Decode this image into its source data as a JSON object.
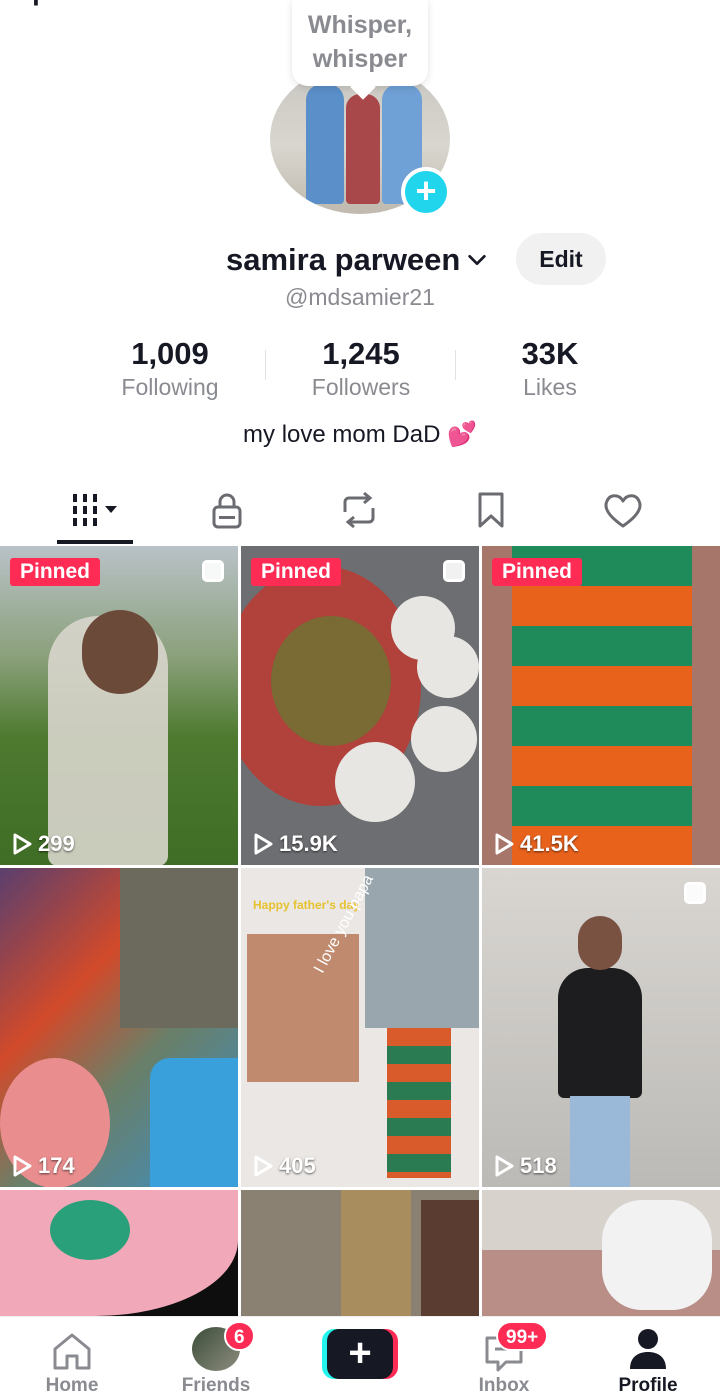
{
  "status": {
    "tooltip": "Whisper, whisper"
  },
  "profile": {
    "display_name": "samira parween",
    "handle": "@mdsamier21",
    "edit_label": "Edit",
    "bio": "my love mom DaD",
    "bio_emoji": "💕"
  },
  "stats": [
    {
      "value": "1,009",
      "label": "Following"
    },
    {
      "value": "1,245",
      "label": "Followers"
    },
    {
      "value": "33K",
      "label": "Likes"
    }
  ],
  "tabs": [
    {
      "icon": "grid-icon",
      "active": true
    },
    {
      "icon": "lock-icon"
    },
    {
      "icon": "repost-icon"
    },
    {
      "icon": "bookmark-icon"
    },
    {
      "icon": "heart-icon"
    }
  ],
  "videos": [
    {
      "pinned_label": "Pinned",
      "views": "299",
      "multi": true
    },
    {
      "pinned_label": "Pinned",
      "views": "15.9K",
      "multi": true
    },
    {
      "pinned_label": "Pinned",
      "views": "41.5K",
      "multi": false
    },
    {
      "views": "174",
      "multi": false
    },
    {
      "views": "405",
      "multi": false,
      "caption_1": "Happy father's day",
      "caption_2": "I love you papa"
    },
    {
      "views": "518",
      "multi": true
    },
    {
      "views": ""
    },
    {
      "views": ""
    },
    {
      "views": ""
    }
  ],
  "bottom_nav": {
    "home": "Home",
    "friends": "Friends",
    "friends_badge": "6",
    "inbox": "Inbox",
    "inbox_badge": "99+",
    "profile": "Profile"
  },
  "colors": {
    "accent": "#fe2c55",
    "cyan": "#25f4ee",
    "text": "#161823",
    "muted": "#8a8b91"
  }
}
